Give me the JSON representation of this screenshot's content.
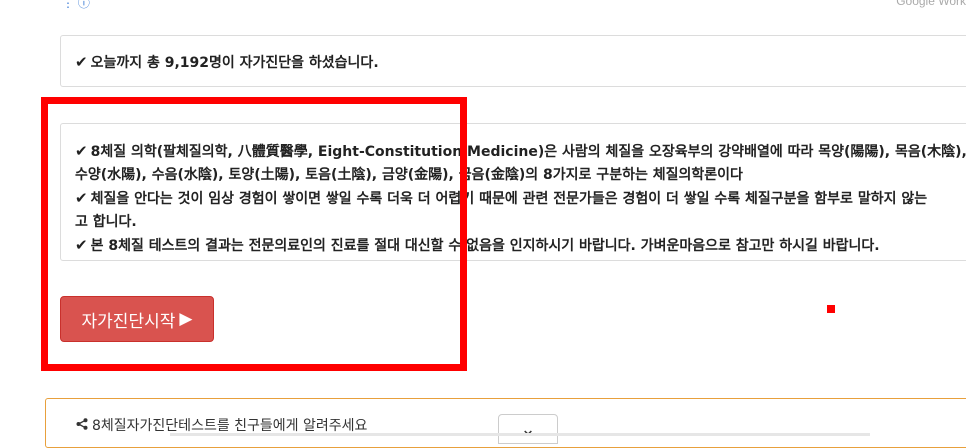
{
  "header": {
    "icons_text": "⋮ ⓘ",
    "right_text": "Google Work"
  },
  "count": {
    "text": "오늘까지 총 9,192명이 자가진단을 하셨습니다."
  },
  "info": {
    "line1": "8체질 의학(팔체질의학, 八體質醫學, Eight-Constitution Medicine)은 사람의 체질을 오장육부의 강약배열에 따라 목양(陽陽), 목음(木陰),",
    "line2": "수양(水陽), 수음(水陰), 토양(土陽), 토음(土陰), 금양(金陽), 금음(金陰)의 8가지로 구분하는 체질의학론이다",
    "line3": "체질을 안다는 것이 임상 경험이 쌓이면 쌓일 수록 더욱 더 어렵기 때문에 관련 전문가들은 경험이 더 쌓일 수록 체질구분을 함부로 말하지 않는",
    "line4": "고 합니다.",
    "line5": "본 8체질 테스트의 결과는 전문의료인의 진료를 절대 대신할 수 없음을 인지하시기 바랍니다. 가벼운마음으로 참고만 하시길 바랍니다."
  },
  "start_button": {
    "label": "자가진단시작"
  },
  "share": {
    "label": "8체질자가진단테스트를 친구들에게 알려주세요"
  },
  "colors": {
    "button_bg": "#d9534f",
    "highlight": "#ff0000",
    "share_border": "#e8a03c"
  }
}
